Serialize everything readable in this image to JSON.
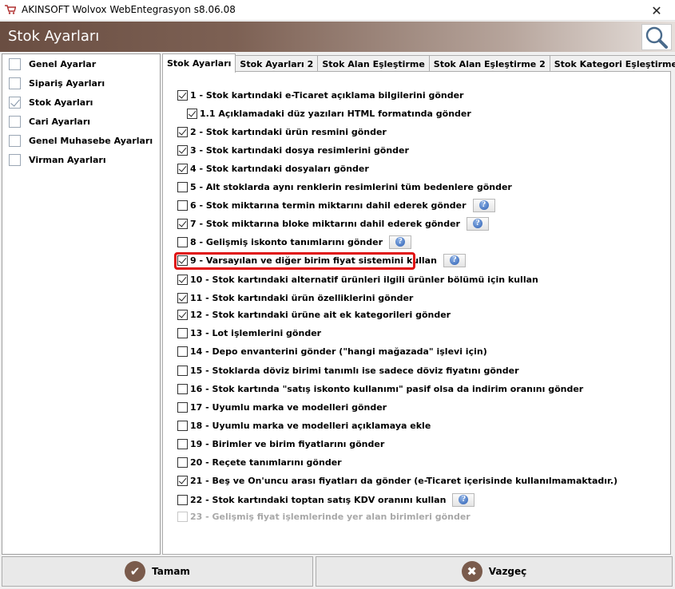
{
  "window": {
    "title": "AKINSOFT Wolvox WebEntegrasyon s8.06.08",
    "close_glyph": "✕"
  },
  "header": {
    "title": "Stok Ayarları"
  },
  "sidebar": {
    "items": [
      {
        "label": "Genel Ayarlar",
        "checked": false
      },
      {
        "label": "Sipariş Ayarları",
        "checked": false
      },
      {
        "label": "Stok Ayarları",
        "checked": true
      },
      {
        "label": "Cari Ayarları",
        "checked": false
      },
      {
        "label": "Genel Muhasebe Ayarları",
        "checked": false
      },
      {
        "label": "Virman Ayarları",
        "checked": false
      }
    ]
  },
  "tabs": [
    {
      "label": "Stok Ayarları",
      "active": true
    },
    {
      "label": "Stok Ayarları 2",
      "active": false
    },
    {
      "label": "Stok Alan Eşleştirme",
      "active": false
    },
    {
      "label": "Stok Alan Eşleştirme 2",
      "active": false
    },
    {
      "label": "Stok Kategori Eşleştirme",
      "active": false
    }
  ],
  "options": [
    {
      "label": "1 - Stok kartındaki e-Ticaret açıklama bilgilerini gönder",
      "checked": true,
      "help": false,
      "indent": false,
      "disabled": false
    },
    {
      "label": "1.1 Açıklamadaki düz yazıları HTML formatında gönder",
      "checked": true,
      "help": false,
      "indent": true,
      "disabled": false
    },
    {
      "label": "2 - Stok kartındaki ürün resmini gönder",
      "checked": true,
      "help": false,
      "indent": false,
      "disabled": false
    },
    {
      "label": "3 - Stok kartındaki dosya resimlerini gönder",
      "checked": true,
      "help": false,
      "indent": false,
      "disabled": false
    },
    {
      "label": "4 - Stok kartındaki dosyaları gönder",
      "checked": true,
      "help": false,
      "indent": false,
      "disabled": false
    },
    {
      "label": "5 - Alt stoklarda aynı renklerin resimlerini tüm bedenlere gönder",
      "checked": false,
      "help": false,
      "indent": false,
      "disabled": false
    },
    {
      "label": "6 - Stok miktarına termin miktarını dahil ederek gönder",
      "checked": false,
      "help": true,
      "indent": false,
      "disabled": false
    },
    {
      "label": "7 - Stok miktarına bloke miktarını dahil ederek gönder",
      "checked": true,
      "help": true,
      "indent": false,
      "disabled": false
    },
    {
      "label": "8 - Gelişmiş iskonto tanımlarını gönder",
      "checked": false,
      "help": true,
      "indent": false,
      "disabled": false
    },
    {
      "label": "9 - Varsayılan ve diğer birim fiyat sistemini kullan",
      "checked": true,
      "help": true,
      "indent": false,
      "disabled": false
    },
    {
      "label": "10 - Stok kartındaki alternatif ürünleri ilgili ürünler bölümü için kullan",
      "checked": true,
      "help": false,
      "indent": false,
      "disabled": false
    },
    {
      "label": "11 - Stok kartındaki ürün özelliklerini gönder",
      "checked": true,
      "help": false,
      "indent": false,
      "disabled": false
    },
    {
      "label": "12 - Stok kartındaki ürüne ait ek kategorileri gönder",
      "checked": true,
      "help": false,
      "indent": false,
      "disabled": false
    },
    {
      "label": "13 - Lot işlemlerini gönder",
      "checked": false,
      "help": false,
      "indent": false,
      "disabled": false
    },
    {
      "label": "14 - Depo envanterini gönder (\"hangi mağazada\" işlevi için)",
      "checked": false,
      "help": false,
      "indent": false,
      "disabled": false
    },
    {
      "label": "15 - Stoklarda döviz birimi tanımlı ise sadece döviz fiyatını gönder",
      "checked": false,
      "help": false,
      "indent": false,
      "disabled": false
    },
    {
      "label": "16 - Stok kartında \"satış iskonto kullanımı\" pasif olsa da indirim oranını gönder",
      "checked": false,
      "help": false,
      "indent": false,
      "disabled": false
    },
    {
      "label": "17 - Uyumlu marka ve modelleri gönder",
      "checked": false,
      "help": false,
      "indent": false,
      "disabled": false
    },
    {
      "label": "18 - Uyumlu marka ve modelleri açıklamaya ekle",
      "checked": false,
      "help": false,
      "indent": false,
      "disabled": false
    },
    {
      "label": "19 - Birimler ve birim fiyatlarını gönder",
      "checked": false,
      "help": false,
      "indent": false,
      "disabled": false
    },
    {
      "label": "20 - Reçete tanımlarını gönder",
      "checked": false,
      "help": false,
      "indent": false,
      "disabled": false
    },
    {
      "label": "21 - Beş ve On'uncu arası fiyatları da gönder (e-Ticaret içerisinde kullanılmamaktadır.)",
      "checked": true,
      "help": false,
      "indent": false,
      "disabled": false
    },
    {
      "label": "22 - Stok kartındaki toptan satış KDV oranını kullan",
      "checked": false,
      "help": true,
      "indent": false,
      "disabled": false
    },
    {
      "label": "23 - Gelişmiş fiyat işlemlerinde yer alan birimleri gönder",
      "checked": false,
      "help": false,
      "indent": false,
      "disabled": true
    }
  ],
  "help_glyph": "?",
  "buttons": {
    "ok": {
      "label": "Tamam",
      "icon": "check-icon",
      "glyph": "✔"
    },
    "cancel": {
      "label": "Vazgeç",
      "icon": "close-icon",
      "glyph": "✖"
    }
  },
  "colors": {
    "header_brown": "#6a4e42",
    "highlight_red": "#e01010",
    "button_icon_brown": "#7a5b4c"
  }
}
